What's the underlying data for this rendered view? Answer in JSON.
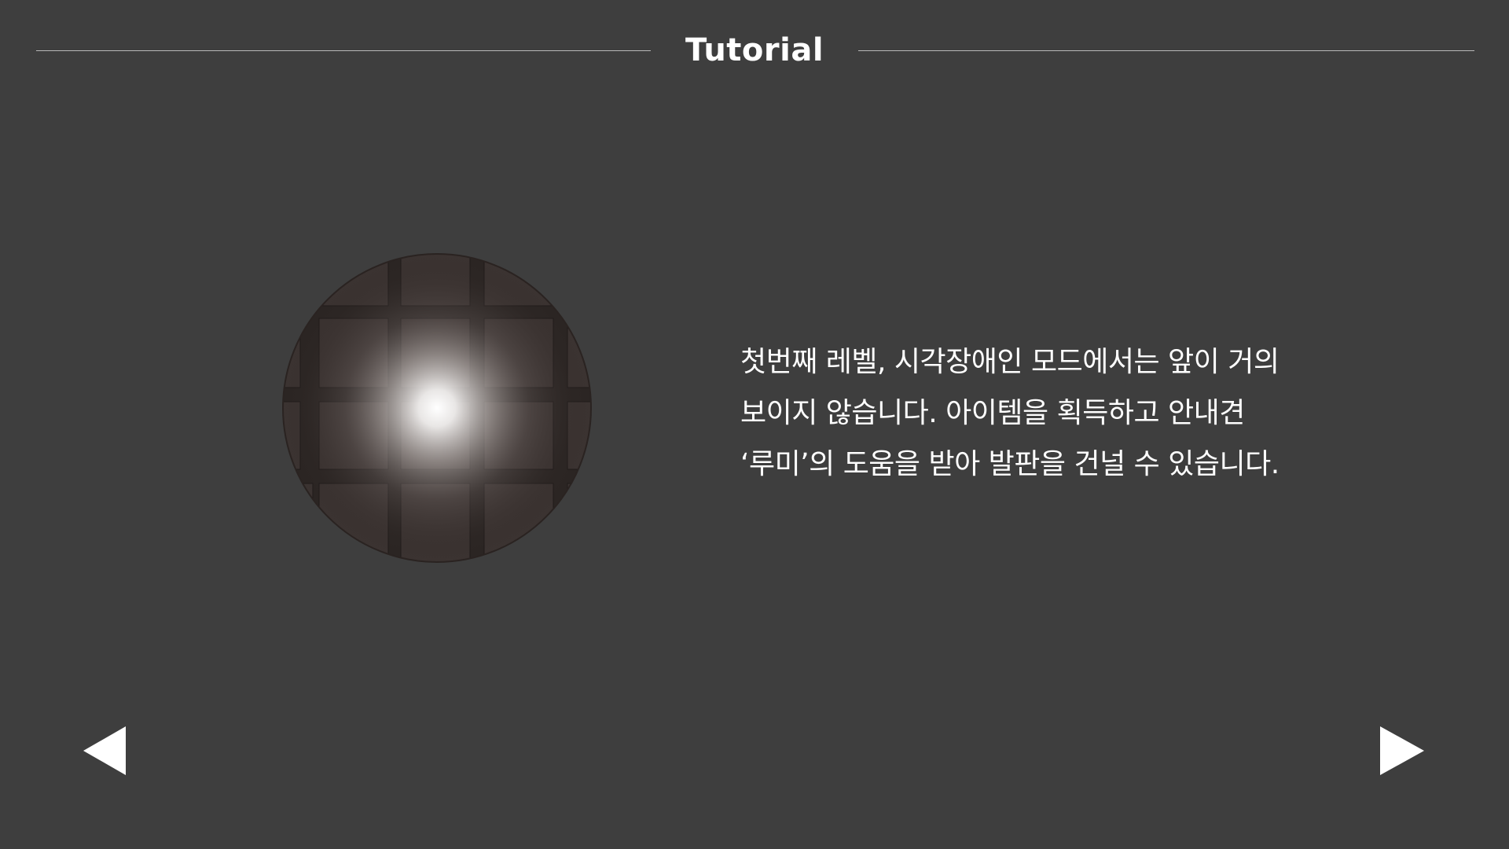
{
  "header": {
    "title": "Tutorial"
  },
  "preview": {
    "icon": "vision-spotlight-grid",
    "colors": {
      "background": "#3e3e3e",
      "tile": "#2b2523",
      "light": "#ffffff"
    }
  },
  "description": {
    "lines": [
      "첫번째 레벨, 시각장애인 모드에서는 앞이 거의",
      "보이지 않습니다. 아이템을 획득하고 안내견",
      "‘루미’의 도움을 받아 발판을 건널 수 있습니다."
    ]
  },
  "navigation": {
    "prev_icon": "triangle-left-icon",
    "next_icon": "triangle-right-icon"
  }
}
